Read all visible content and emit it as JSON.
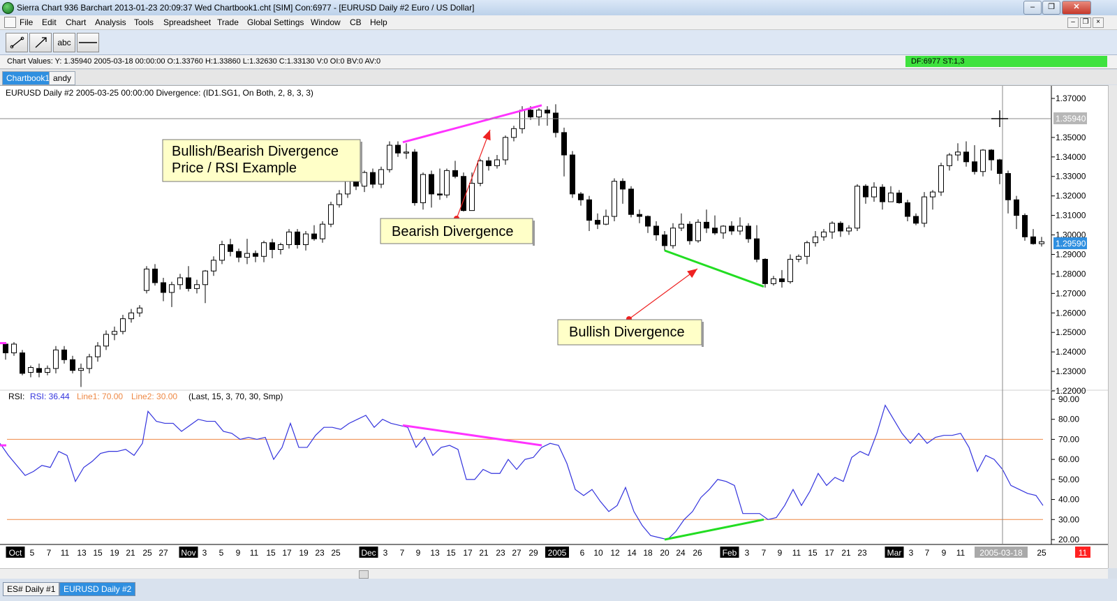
{
  "window": {
    "title": "Sierra Chart 936 Barchart 2013-01-23  20:09:37 Wed  Chartbook1.cht [SIM] Con:6977 - [EURUSD  Daily  #2  Euro / US Dollar]"
  },
  "menu": [
    "File",
    "Edit",
    "Chart",
    "Analysis",
    "Tools",
    "Spreadsheet",
    "Trade",
    "Global Settings",
    "Window",
    "CB",
    "Help"
  ],
  "toolbar": {
    "line_tool": "line",
    "ray_tool": "ray",
    "text_tool": "abc",
    "hline_tool": "horizontal line"
  },
  "values_bar": {
    "text": "Chart Values: Y: 1.35940  2005-03-18  00:00:00  O:1.33760  H:1.33860  L:1.32630  C:1.33130  V:0  OI:0  BV:0  AV:0",
    "status": "DF:6977  ST:1,3",
    "status_color": "#3fe23f"
  },
  "tabs": [
    "Chartbook1",
    "andy"
  ],
  "chart": {
    "header": "EURUSD  Daily  #2 2005-03-25 00:00:00 Divergence:   (ID1.SG1, On Both, 2, 8, 3, 3)",
    "price_axis": [
      "1.37000",
      "1.36000",
      "1.35000",
      "1.34000",
      "1.33000",
      "1.32000",
      "1.31000",
      "1.30000",
      "1.29000",
      "1.28000",
      "1.27000",
      "1.26000",
      "1.25000",
      "1.24000",
      "1.23000",
      "1.22000"
    ],
    "crosshair_price": "1.35940",
    "last_price": "1.29590",
    "last_price_color": "#2f8fe0",
    "annotations": {
      "title_line1": "Bullish/Bearish Divergence",
      "title_line2": "Price / RSI Example",
      "bearish": "Bearish Divergence",
      "bullish": "Bullish Divergence"
    },
    "rsi_header": {
      "name": "RSI:",
      "value": "RSI: 36.44",
      "line1": "Line1: 70.00",
      "line2": "Line2: 30.00",
      "params": "(Last, 15, 3, 70, 30, Smp)"
    },
    "rsi_axis": [
      "90.00",
      "80.00",
      "70.00",
      "60.00",
      "50.00",
      "40.00",
      "30.00",
      "20.00"
    ],
    "date_labels": [
      "Oct",
      "5",
      "7",
      "11",
      "13",
      "15",
      "19",
      "21",
      "25",
      "27",
      "Nov",
      "3",
      "5",
      "9",
      "11",
      "15",
      "17",
      "19",
      "23",
      "25",
      "Dec",
      "3",
      "7",
      "9",
      "13",
      "15",
      "17",
      "21",
      "23",
      "27",
      "29",
      "2005",
      "6",
      "10",
      "12",
      "14",
      "18",
      "20",
      "24",
      "26",
      "Feb",
      "3",
      "7",
      "9",
      "11",
      "15",
      "17",
      "21",
      "23",
      "Mar",
      "3",
      "7",
      "9",
      "11",
      "2005-03-18",
      "25"
    ],
    "crosshair_date": "2005-03-18",
    "corner_badge": "11",
    "colors": {
      "bearish_line": "#ff33ff",
      "bullish_line": "#22dd22",
      "rsi_line": "#3333dd",
      "rsi_levels": "#ee8844",
      "arrow": "#ee2222"
    }
  },
  "bottom_tabs": [
    "ES#  Daily  #1",
    "EURUSD  Daily  #2"
  ]
}
